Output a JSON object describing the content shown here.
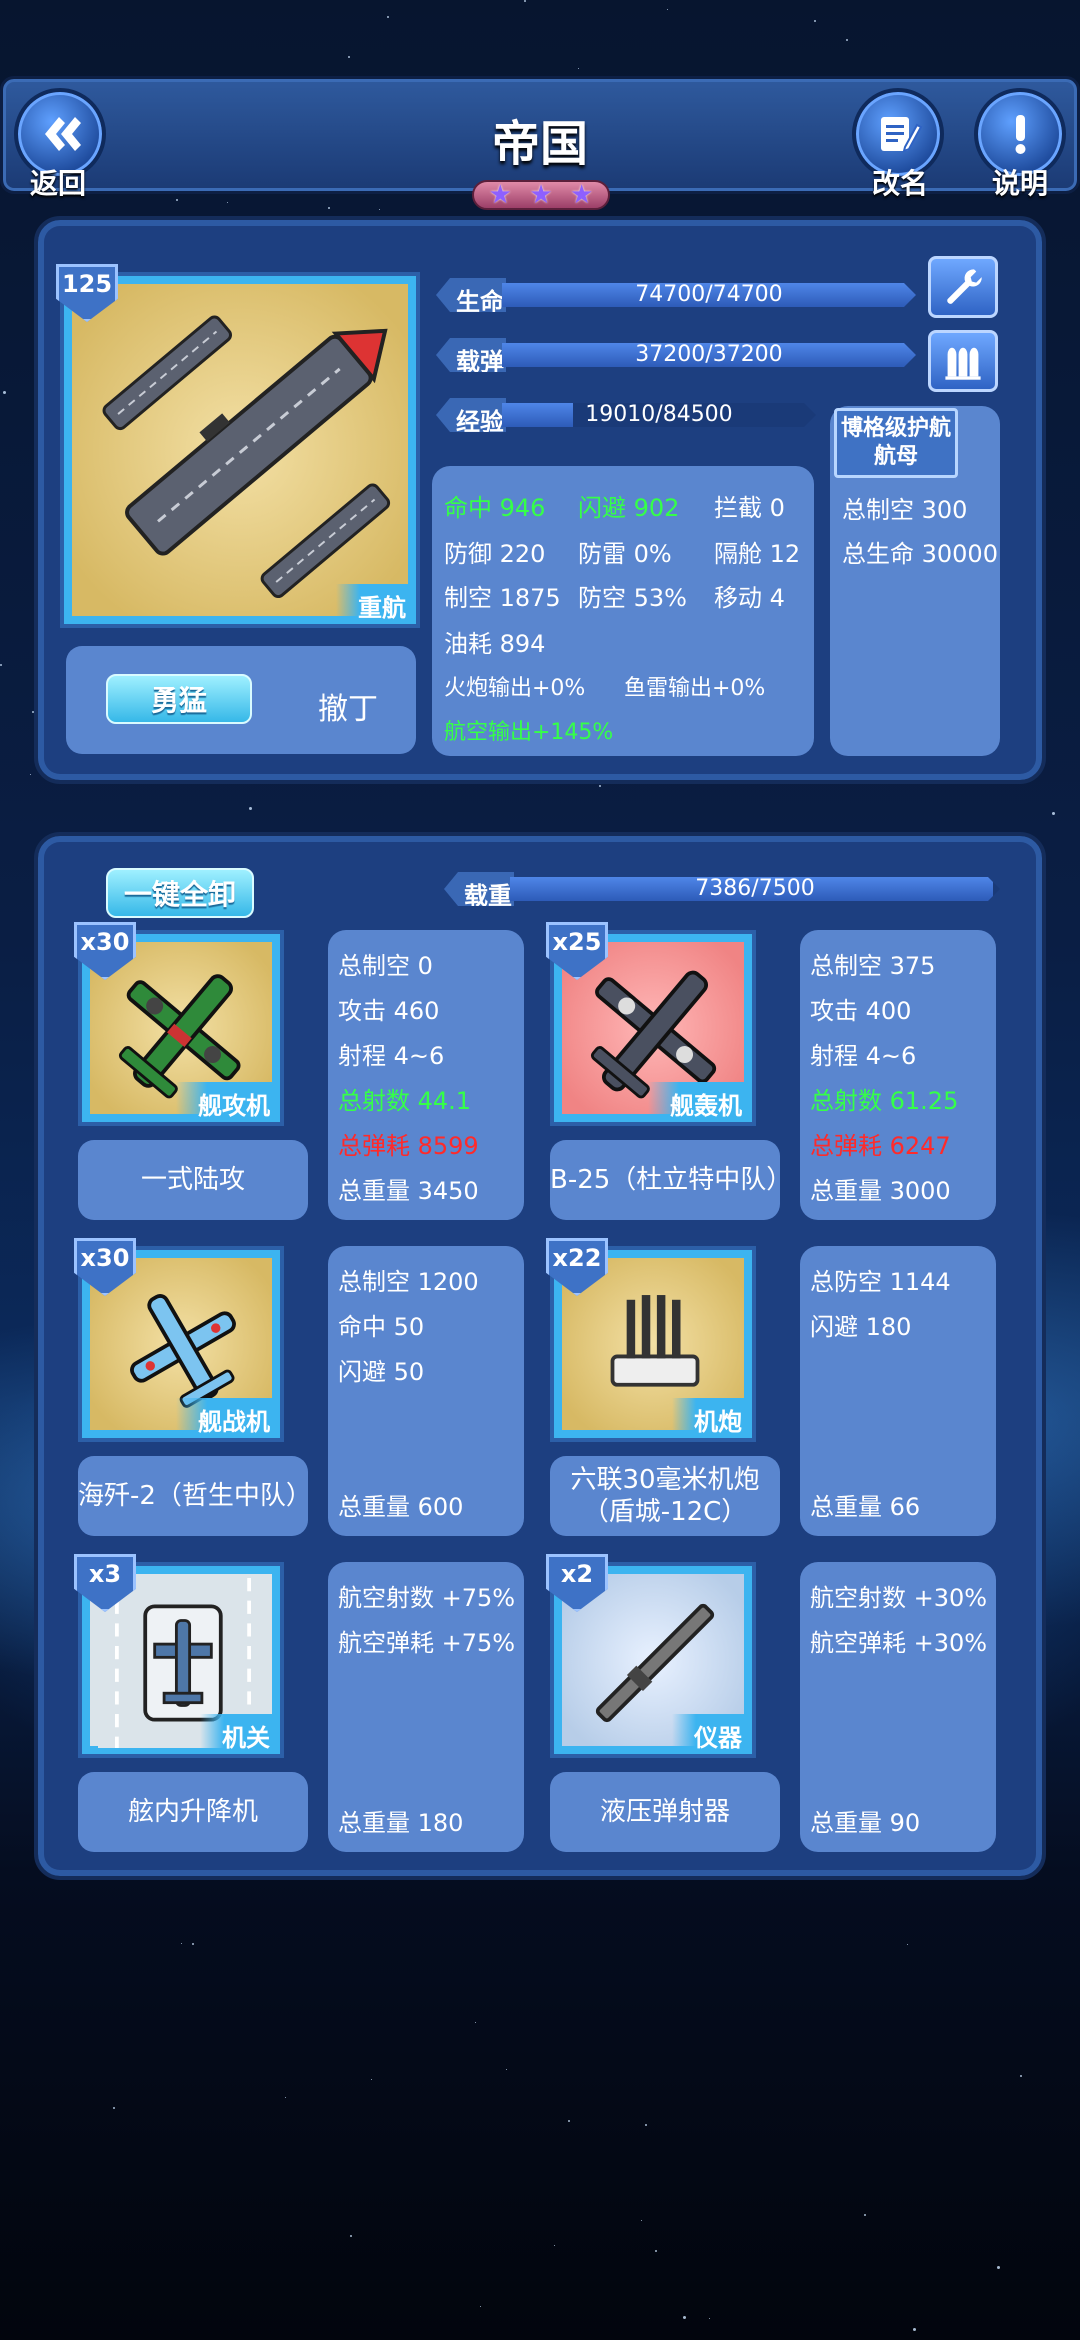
{
  "header": {
    "back_label": "返回",
    "title": "帝国",
    "rename_label": "改名",
    "help_label": "说明",
    "star_rating": 3
  },
  "ship": {
    "level": "125",
    "class_tag": "重航",
    "stance_button": "勇猛",
    "retreat_label": "撤丁",
    "bars": [
      {
        "label": "生命",
        "value": "74700/74700",
        "fraction": 1.0
      },
      {
        "label": "载弹",
        "value": "37200/37200",
        "fraction": 1.0
      },
      {
        "label": "经验",
        "value": "19010/84500",
        "fraction": 0.225
      }
    ],
    "escort_button": "博格级护航航母",
    "escort_stats": [
      "总制空 300",
      "总生命 30000"
    ],
    "stats": {
      "row1": [
        "命中 946",
        "闪避 902",
        "拦截 0"
      ],
      "row2": [
        "防御 220",
        "防雷 0%",
        "隔舱 12"
      ],
      "row3": [
        "制空 1875",
        "防空 53%",
        "移动 4"
      ],
      "row4": [
        "油耗 894"
      ],
      "row5": [
        "火炮输出+0%",
        "鱼雷输出+0%"
      ],
      "row6": [
        "航空输出+145%"
      ]
    },
    "colors": {
      "green": "#35ff48",
      "red": "#ff2a2a",
      "accent": "#3cb4f0"
    }
  },
  "loadout": {
    "unload_all_button": "一键全卸",
    "capacity_label": "载重",
    "capacity_value": "7386/7500",
    "capacity_fraction": 0.9848,
    "items": [
      {
        "count": "x30",
        "icon": "torpedo-bomber-icon",
        "type": "舰攻机",
        "name": "一式陆攻",
        "stats": [
          "总制空 0",
          "攻击 460",
          "射程 4~6"
        ],
        "green": "总射数 44.1",
        "red": "总弹耗 8599",
        "weight": "总重量 3450"
      },
      {
        "count": "x25",
        "icon": "dive-bomber-icon",
        "type": "舰轰机",
        "name": "B-25（杜立特中队）",
        "stats": [
          "总制空 375",
          "攻击 400",
          "射程 4~6"
        ],
        "green": "总射数 61.25",
        "red": "总弹耗 6247",
        "weight": "总重量 3000"
      },
      {
        "count": "x30",
        "icon": "fighter-icon",
        "type": "舰战机",
        "name": "海歼-2（哲生中队）",
        "stats": [
          "总制空 1200",
          "命中 50",
          "闪避 50"
        ],
        "green": "",
        "red": "",
        "weight": "总重量 600"
      },
      {
        "count": "x22",
        "icon": "aa-gun-icon",
        "type": "机炮",
        "name": "六联30毫米机炮（盾城-12C）",
        "stats": [
          "总防空 1144",
          "闪避 180"
        ],
        "green": "",
        "red": "",
        "weight": "总重量 66"
      },
      {
        "count": "x3",
        "icon": "elevator-icon",
        "type": "机关",
        "name": "舷内升降机",
        "stats": [
          "航空射数 +75%",
          "航空弹耗 +75%"
        ],
        "green": "",
        "red": "",
        "weight": "总重量 180"
      },
      {
        "count": "x2",
        "icon": "catapult-icon",
        "type": "仪器",
        "name": "液压弹射器",
        "stats": [
          "航空射数 +30%",
          "航空弹耗 +30%"
        ],
        "green": "",
        "red": "",
        "weight": "总重量 90"
      }
    ]
  }
}
